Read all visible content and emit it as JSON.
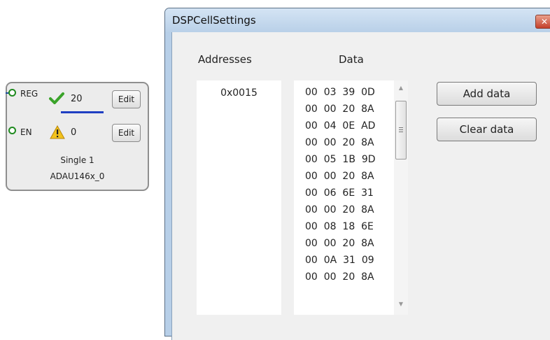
{
  "cell_block": {
    "reg_label": "REG",
    "reg_value": "20",
    "reg_edit_label": "Edit",
    "en_label": "EN",
    "en_value": "0",
    "en_edit_label": "Edit",
    "name": "Single 1",
    "subtitle": "ADAU146x_0",
    "icons": {
      "reg_status": "check-icon",
      "en_status": "warning-icon"
    },
    "colors": {
      "check": "#3aa32a",
      "warning": "#f2c21b",
      "underline": "#1f3fc2",
      "pin": "#1f8a1f"
    }
  },
  "window": {
    "title": "DSPCellSettings",
    "close_icon": "close-icon",
    "addresses_header": "Addresses",
    "data_header": "Data",
    "addresses": [
      "0x0015"
    ],
    "data_rows": [
      "00  03  39  0D",
      "00  00  20  8A",
      "00  04  0E  AD",
      "00  00  20  8A",
      "00  05  1B  9D",
      "00  00  20  8A",
      "00  06  6E  31",
      "00  00  20  8A",
      "00  08  18  6E",
      "00  00  20  8A",
      "00  0A  31  09",
      "00  00  20  8A"
    ],
    "add_button_label": "Add data",
    "clear_button_label": "Clear data"
  }
}
